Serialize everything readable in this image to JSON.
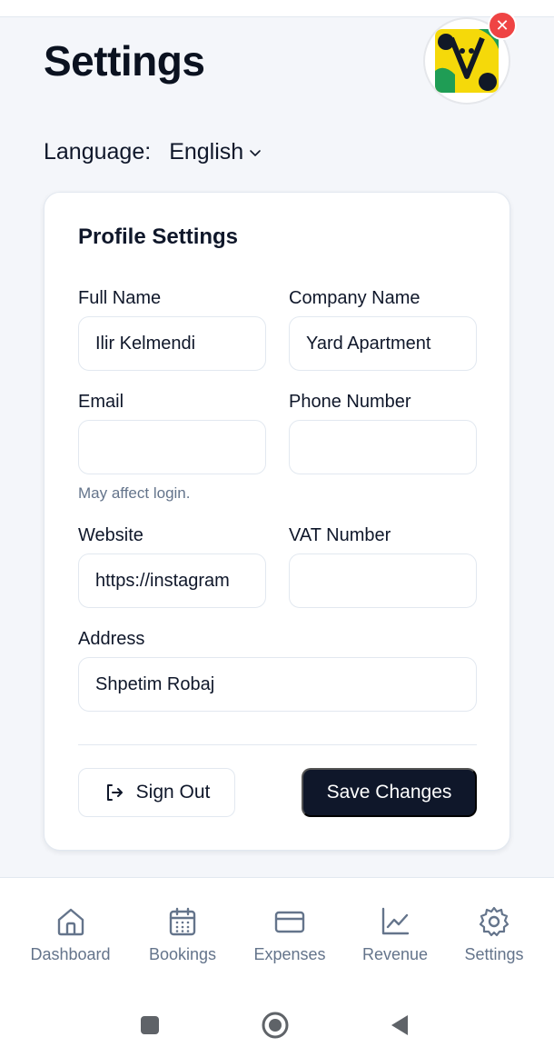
{
  "page": {
    "title": "Settings"
  },
  "language": {
    "label": "Language:",
    "value": "English"
  },
  "profile": {
    "title": "Profile Settings",
    "full_name": {
      "label": "Full Name",
      "value": "Ilir Kelmendi"
    },
    "company_name": {
      "label": "Company Name",
      "value": "Yard Apartment"
    },
    "email": {
      "label": "Email",
      "value": "",
      "help": "May affect login."
    },
    "phone": {
      "label": "Phone Number",
      "value": ""
    },
    "website": {
      "label": "Website",
      "value": "https://instagram"
    },
    "vat": {
      "label": "VAT Number",
      "value": ""
    },
    "address": {
      "label": "Address",
      "value": "Shpetim Robaj"
    }
  },
  "actions": {
    "sign_out": "Sign Out",
    "save": "Save Changes"
  },
  "nav": {
    "items": [
      {
        "label": "Dashboard",
        "icon": "home-icon"
      },
      {
        "label": "Bookings",
        "icon": "calendar-icon"
      },
      {
        "label": "Expenses",
        "icon": "credit-card-icon"
      },
      {
        "label": "Revenue",
        "icon": "chart-line-icon"
      },
      {
        "label": "Settings",
        "icon": "gear-icon"
      }
    ]
  },
  "colors": {
    "primary": "#0f172a",
    "muted": "#64748b",
    "danger": "#ef4444",
    "background": "#f4f6fa"
  }
}
